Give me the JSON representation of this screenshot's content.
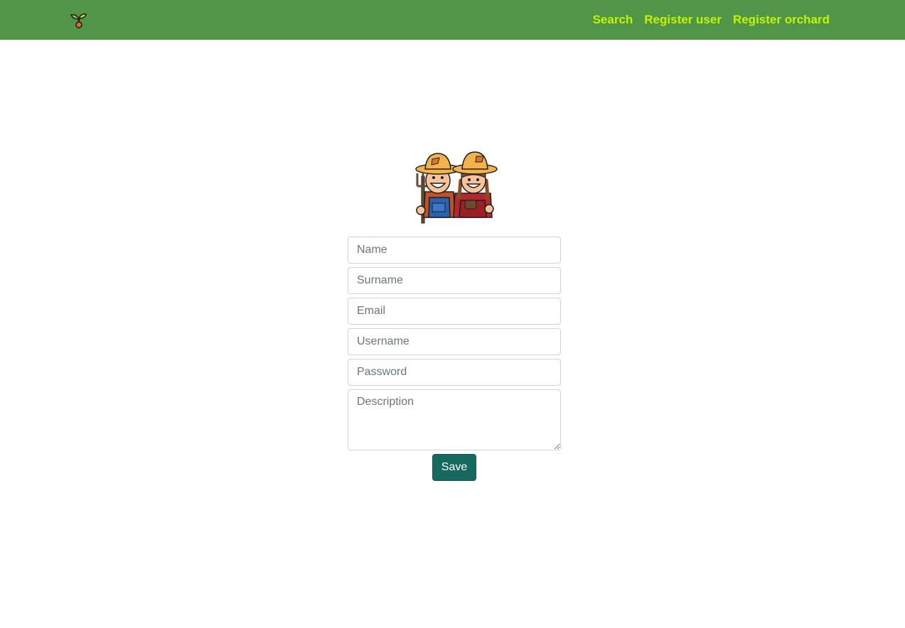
{
  "navbar": {
    "logo_icon": "sprout-icon",
    "links": [
      {
        "label": "Search"
      },
      {
        "label": "Register user"
      },
      {
        "label": "Register orchard"
      }
    ],
    "background_color": "#519548",
    "link_color": "#c6f400"
  },
  "illustration": {
    "icon": "farmers-couple-illustration"
  },
  "form": {
    "name_placeholder": "Name",
    "surname_placeholder": "Surname",
    "email_placeholder": "Email",
    "username_placeholder": "Username",
    "password_placeholder": "Password",
    "description_placeholder": "Description",
    "save_label": "Save",
    "save_color": "#17685f"
  }
}
